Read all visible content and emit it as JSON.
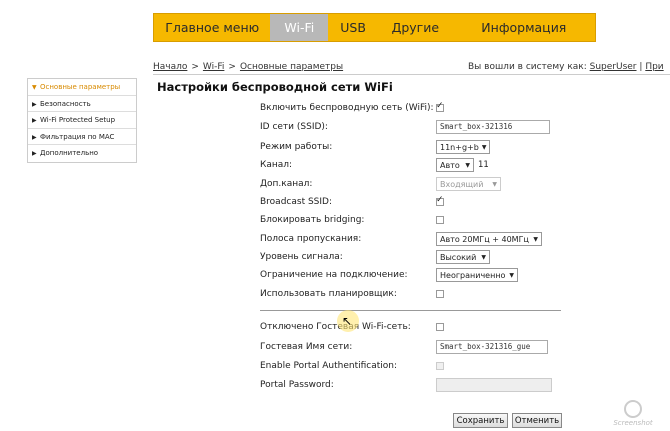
{
  "nav": {
    "tabs": [
      {
        "label": "Главное меню"
      },
      {
        "label": "Wi-Fi"
      },
      {
        "label": "USB"
      },
      {
        "label": "Другие"
      },
      {
        "label": "Информация"
      }
    ]
  },
  "breadcrumb": {
    "items": [
      "Начало",
      "Wi-Fi",
      "Основные параметры"
    ],
    "separator": ">"
  },
  "login": {
    "prefix": "Вы вошли в систему как:",
    "user": "SuperUser",
    "tail": "При"
  },
  "sidebar": {
    "items": [
      {
        "label": "Основные параметры"
      },
      {
        "label": "Безопасность"
      },
      {
        "label": "Wi-Fi Protected Setup"
      },
      {
        "label": "Фильтрация по MAC"
      },
      {
        "label": "Дополнительно"
      }
    ]
  },
  "page_title": "Настройки беспроводной сети WiFi",
  "form": {
    "enable_wifi": {
      "label": "Включить беспроводную сеть (WiFi):",
      "checked": true
    },
    "ssid": {
      "label": "ID сети (SSID):",
      "value": "Smart_box-321316"
    },
    "mode": {
      "label": "Режим работы:",
      "value": "11n+g+b"
    },
    "channel": {
      "label": "Канал:",
      "value": "Авто",
      "current": "11"
    },
    "ext_channel": {
      "label": "Доп.канал:",
      "value": "Входящий"
    },
    "broadcast_ssid": {
      "label": "Broadcast SSID:",
      "checked": true
    },
    "block_bridging": {
      "label": "Блокировать bridging:",
      "checked": false
    },
    "bandwidth": {
      "label": "Полоса пропускания:",
      "value": "Авто 20МГц + 40МГц"
    },
    "signal_level": {
      "label": "Уровень сигнала:",
      "value": "Высокий"
    },
    "conn_limit": {
      "label": "Ограничение на подключение:",
      "value": "Неограниченно"
    },
    "scheduler": {
      "label": "Использовать планировщик:",
      "checked": false
    },
    "guest_disabled": {
      "label": "Отключено Гостевая Wi-Fi-сеть:",
      "checked": false
    },
    "guest_name": {
      "label": "Гостевая Имя сети:",
      "value": "Smart_box-321316_gue"
    },
    "portal_auth": {
      "label": "Enable Portal Authentification:",
      "checked": false
    },
    "portal_password": {
      "label": "Portal Password:",
      "value": ""
    }
  },
  "buttons": {
    "save": "Сохранить",
    "cancel": "Отменить"
  },
  "watermark": "Screenshot",
  "colors": {
    "nav_bg": "#f6b800",
    "nav_active": "#b8b8b8",
    "sidebar_active": "#d88a00"
  }
}
